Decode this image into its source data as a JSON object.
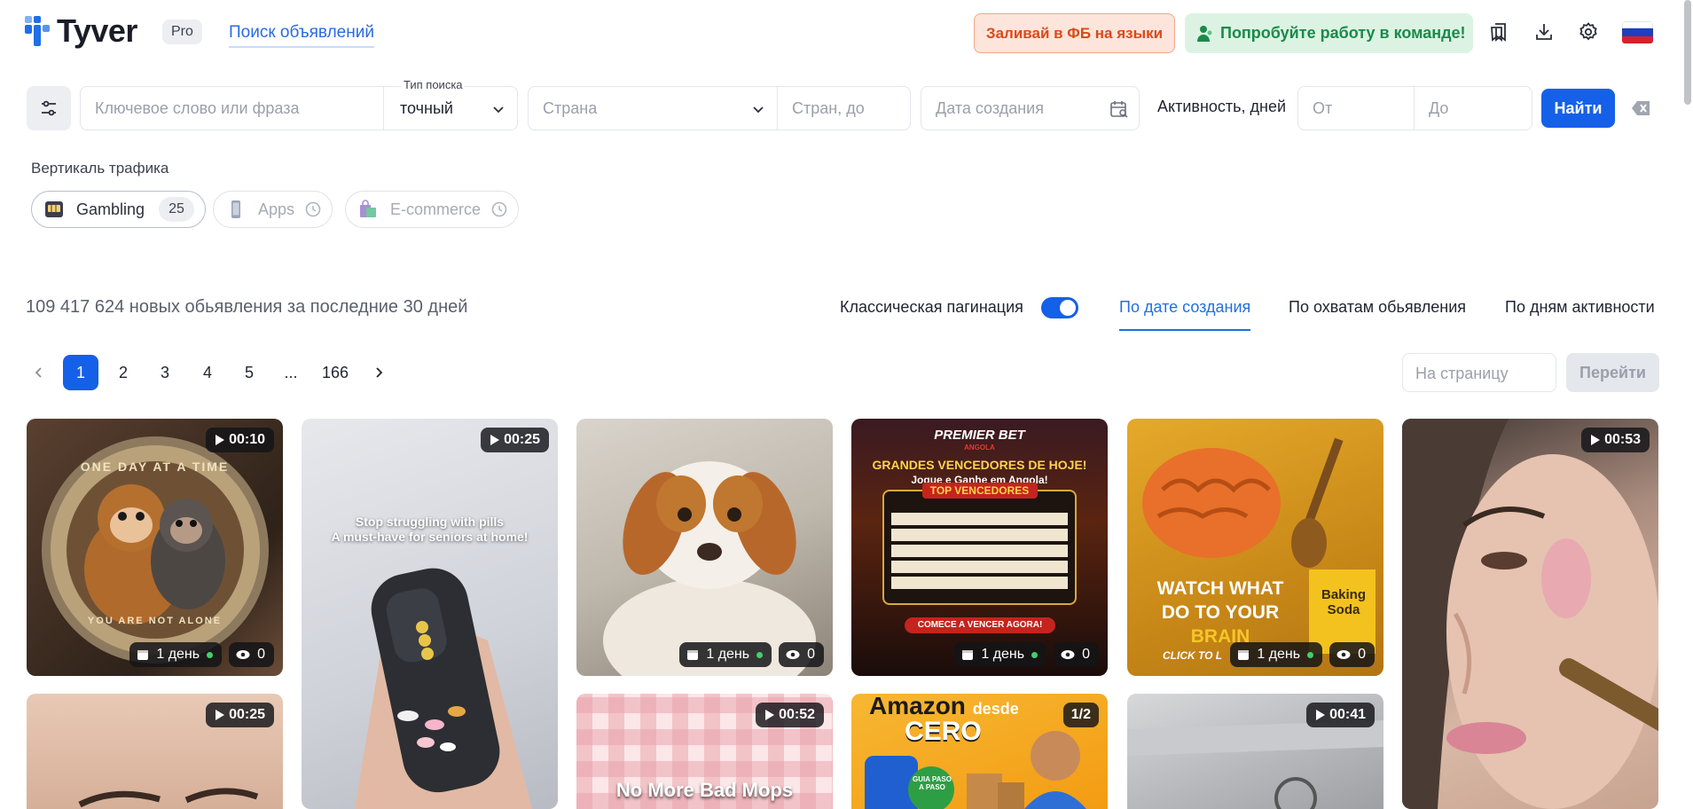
{
  "header": {
    "logo": "Tyver",
    "pro": "Pro",
    "search_link": "Поиск объявлений",
    "promo_fb": "Заливай в ФБ на языки",
    "promo_team": "Попробуйте работу в команде!",
    "icons": [
      "bookmarks-icon",
      "download-icon",
      "settings-icon",
      "flag-ru-icon"
    ]
  },
  "filters": {
    "keyword_placeholder": "Ключевое слово или фраза",
    "search_type_label": "Тип поиска",
    "search_type_value": "точный",
    "country_placeholder": "Страна",
    "country_to_placeholder": "Стран, до",
    "date_placeholder": "Дата создания",
    "activity_label": "Активность, дней",
    "from_placeholder": "От",
    "to_placeholder": "До",
    "find": "Найти"
  },
  "vertical": {
    "title": "Вертикаль трафика",
    "chips": [
      {
        "label": "Gambling",
        "count": "25",
        "active": true
      },
      {
        "label": "Apps",
        "active": false
      },
      {
        "label": "E-commerce",
        "active": false
      }
    ]
  },
  "results": {
    "count_text": "109 417 624 новых обьявления за последние 30 дней",
    "pagination_label": "Классическая пагинация",
    "pagination_toggle": true,
    "sort": [
      "По дате создания",
      "По охватам обьявления",
      "По дням активности"
    ],
    "sort_active": "По дате создания"
  },
  "pagination": {
    "pages": [
      "1",
      "2",
      "3",
      "4",
      "5",
      "...",
      "166"
    ],
    "current": "1",
    "per_page_placeholder": "На страницу",
    "go": "Перейти"
  },
  "cards": [
    {
      "duration": "00:10",
      "age": "1 день",
      "views": "0",
      "coin_top": "ONE DAY AT A TIME",
      "coin_bottom": "YOU ARE NOT ALONE"
    },
    {
      "duration": "00:25",
      "text": "Stop struggling with pills\nA must-have for seniors at home!"
    },
    {
      "age": "1 день",
      "views": "0"
    },
    {
      "age": "1 день",
      "views": "0",
      "brand": "PREMIER BET",
      "brand_sub": "ANGOLA",
      "headline": "GRANDES VENCEDORES DE HOJE!",
      "sub": "Jogue e Ganhe em Angola!",
      "table_title": "TOP VENCEDORES",
      "cta": "COMECE A VENCER AGORA!"
    },
    {
      "age": "1 день",
      "views": "0",
      "text1": "WATCH WHAT",
      "text2": "DO TO YOUR",
      "text3": "BRAIN",
      "box": "Baking Soda",
      "click": "CLICK TO L"
    },
    {
      "duration": "00:53"
    },
    {
      "duration": "00:25"
    },
    {
      "duration": "00:52",
      "text": "No More Bad Mops"
    },
    {
      "pager": "1/2",
      "title1": "Amazon",
      "title2": "desde",
      "title3": "CERO",
      "badge": "GUIA PASO A PASO"
    },
    {
      "duration": "00:41"
    }
  ],
  "colors": {
    "accent": "#1560e8",
    "fb_promo": "#d94a1a",
    "team_promo": "#1b8a4a"
  }
}
